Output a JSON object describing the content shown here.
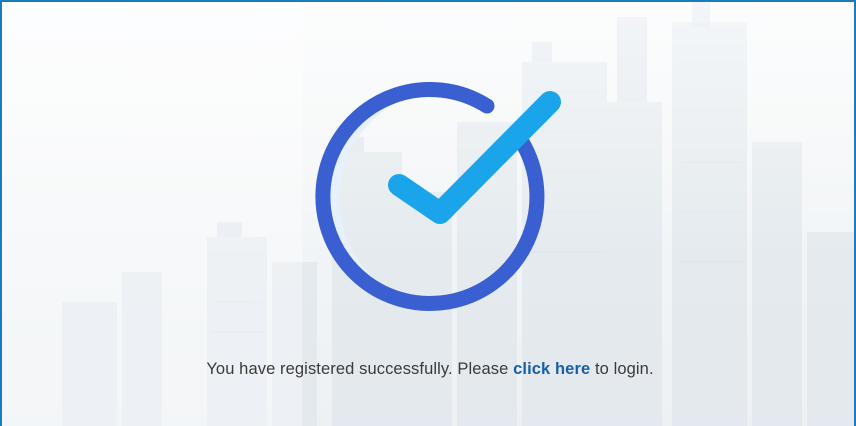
{
  "colors": {
    "frame_border": "#1b7bbf",
    "circle_stroke": "#3a5fd1",
    "check_stroke": "#1aa5ea",
    "crescent_fill": "#e6f1fb",
    "link": "#1661a6",
    "text": "#3a3a3a"
  },
  "icon": {
    "name": "success-check-circle-icon"
  },
  "message": {
    "prefix": "You have registered successfully. Please ",
    "link_text": "click here",
    "suffix": " to login."
  }
}
